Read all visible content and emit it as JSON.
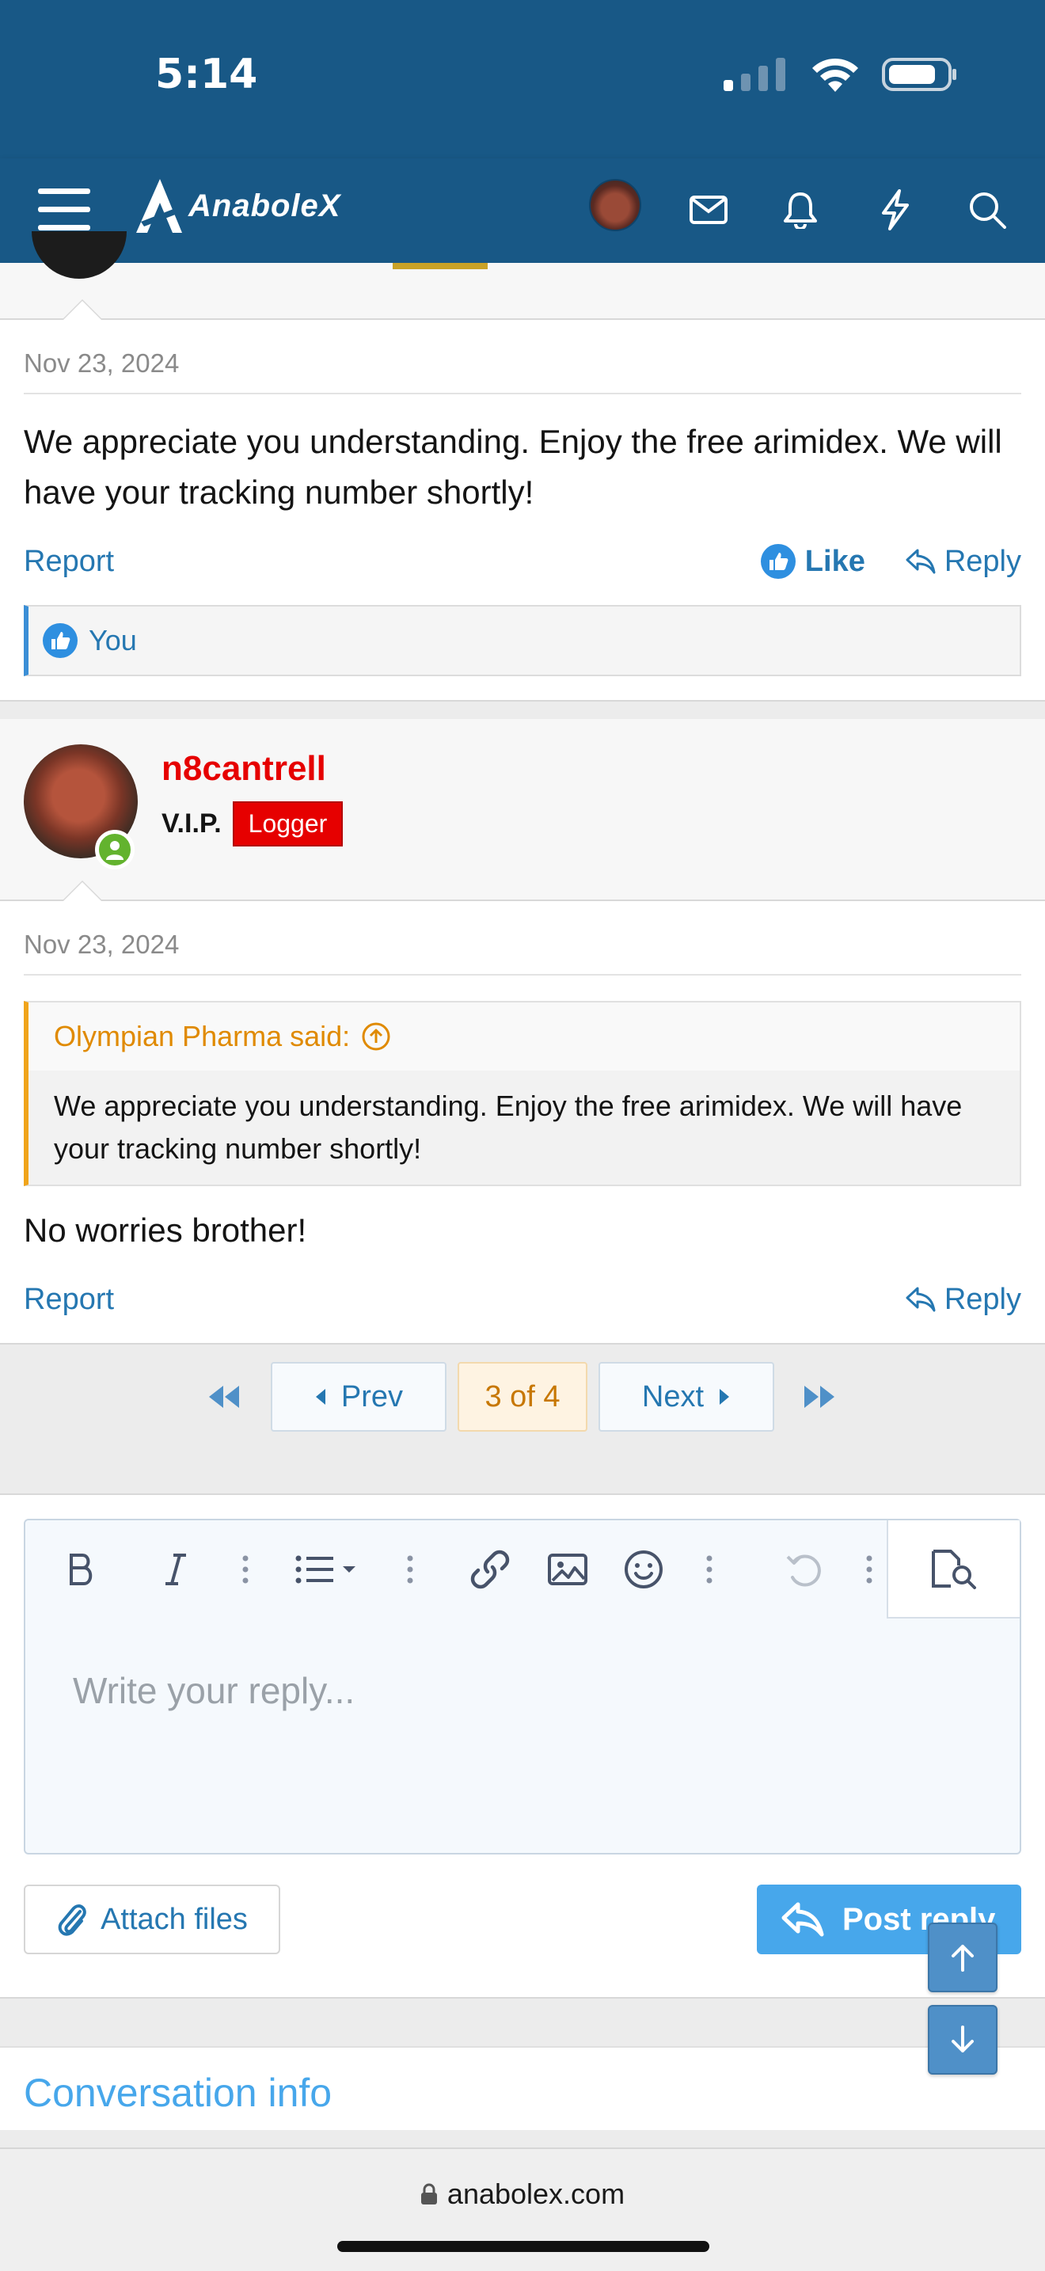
{
  "status_bar": {
    "time": "5:14"
  },
  "navbar": {
    "logo_text": "AnaboleX"
  },
  "post1": {
    "date": "Nov 23, 2024",
    "text": "We appreciate you understanding. Enjoy the free arimidex. We will have your tracking number shortly!",
    "report_label": "Report",
    "like_label": "Like",
    "reply_label": "Reply",
    "reaction_text": "You"
  },
  "post2": {
    "username": "n8cantrell",
    "user_title": "V.I.P.",
    "badge": "Logger",
    "date": "Nov 23, 2024",
    "quote_author": "Olympian Pharma said:",
    "quote_text": "We appreciate you understanding. Enjoy the free arimidex. We will have your tracking number shortly!",
    "text": "No worries brother!",
    "report_label": "Report",
    "reply_label": "Reply"
  },
  "pagination": {
    "prev_label": "Prev",
    "current": "3 of 4",
    "next_label": "Next"
  },
  "editor": {
    "placeholder": "Write your reply..."
  },
  "actions": {
    "attach_label": "Attach files",
    "post_reply_label": "Post reply"
  },
  "conversation_info": {
    "label": "Conversation info"
  },
  "browser": {
    "url": "anabolex.com"
  },
  "colors": {
    "nav_bg": "#185886",
    "link": "#2577b1",
    "username": "#e60000",
    "quote_accent": "#f0a41b",
    "button": "#47a7eb"
  }
}
